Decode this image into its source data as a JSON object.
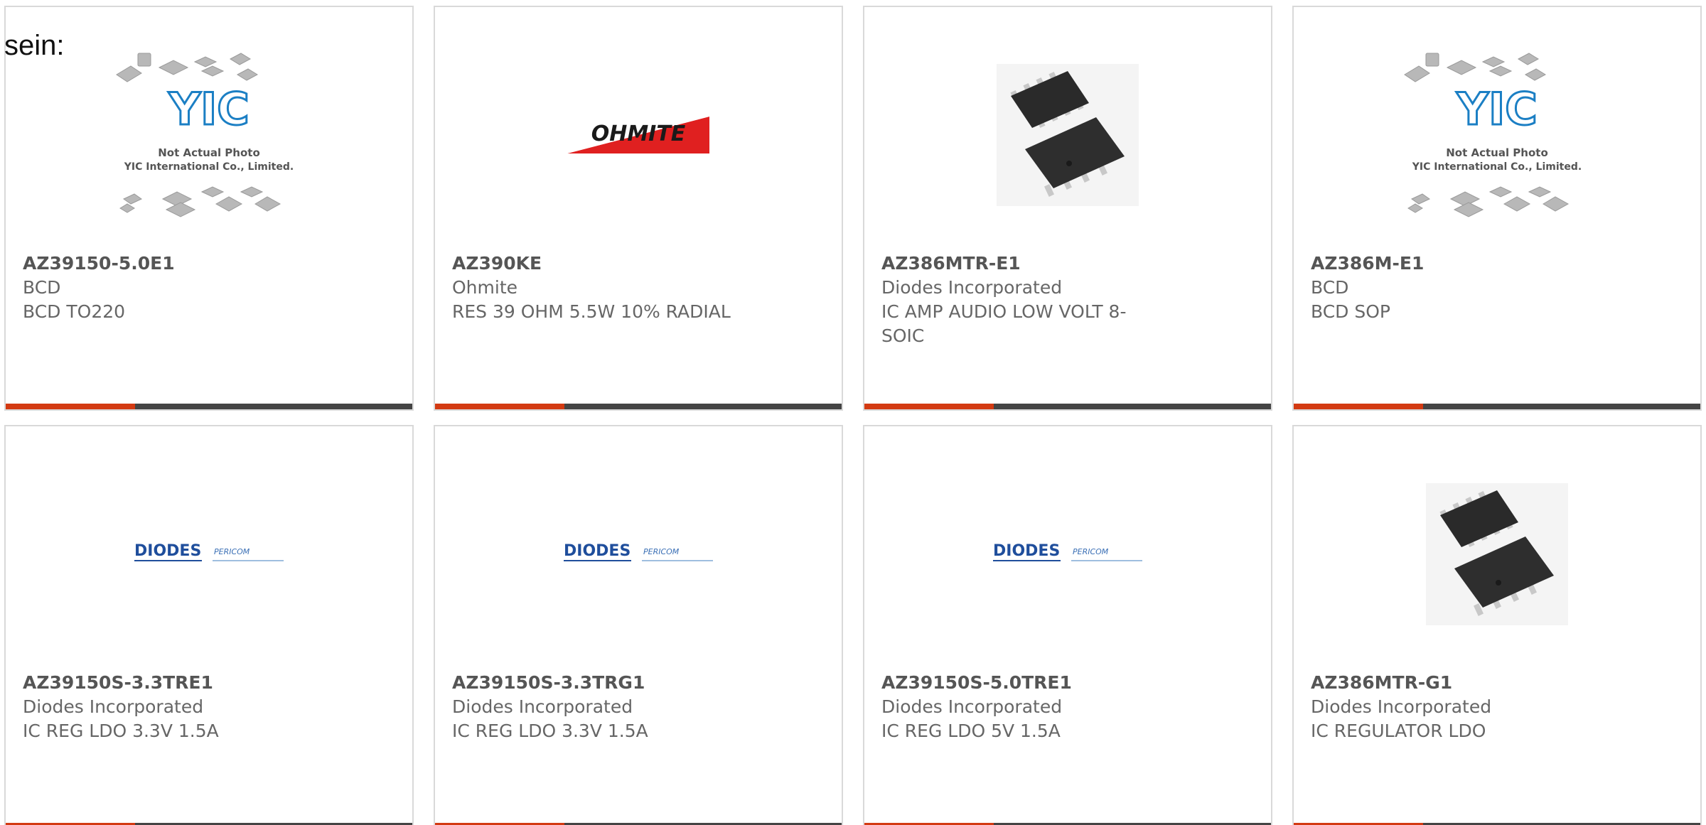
{
  "lead_text": "sein:",
  "colors": {
    "accent": "#d33a12",
    "bar": "#444444",
    "border": "#d9d9d9",
    "text": "#666666"
  },
  "products": [
    {
      "part_number": "AZ39150-5.0E1",
      "manufacturer": "BCD",
      "description": "BCD TO220",
      "image": "yic-placeholder",
      "placeholder_line1": "Not Actual Photo",
      "placeholder_line2": "YIC International Co., Limited."
    },
    {
      "part_number": "AZ390KE",
      "manufacturer": "Ohmite",
      "description": "RES 39 OHM 5.5W 10% RADIAL",
      "image": "ohmite-logo",
      "logo_text": "OHMITE"
    },
    {
      "part_number": "AZ386MTR-E1",
      "manufacturer": "Diodes Incorporated",
      "description": "IC AMP AUDIO LOW VOLT 8-SOIC",
      "image": "soic-chip"
    },
    {
      "part_number": "AZ386M-E1",
      "manufacturer": "BCD",
      "description": "BCD SOP",
      "image": "yic-placeholder",
      "placeholder_line1": "Not Actual Photo",
      "placeholder_line2": "YIC International Co., Limited."
    },
    {
      "part_number": "AZ39150S-3.3TRE1",
      "manufacturer": "Diodes Incorporated",
      "description": "IC REG LDO 3.3V 1.5A",
      "image": "diodes-logo",
      "logo_text": "DIODES",
      "logo_text2": "PERICOM"
    },
    {
      "part_number": "AZ39150S-3.3TRG1",
      "manufacturer": "Diodes Incorporated",
      "description": "IC REG LDO 3.3V 1.5A",
      "image": "diodes-logo",
      "logo_text": "DIODES",
      "logo_text2": "PERICOM"
    },
    {
      "part_number": "AZ39150S-5.0TRE1",
      "manufacturer": "Diodes Incorporated",
      "description": "IC REG LDO 5V 1.5A",
      "image": "diodes-logo",
      "logo_text": "DIODES",
      "logo_text2": "PERICOM"
    },
    {
      "part_number": "AZ386MTR-G1",
      "manufacturer": "Diodes Incorporated",
      "description": "IC REGULATOR LDO",
      "image": "soic-chip"
    }
  ]
}
